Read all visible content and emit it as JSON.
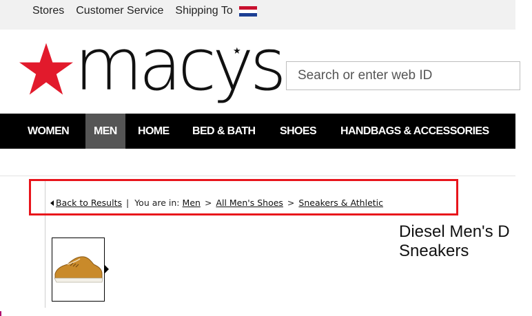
{
  "topbar": {
    "stores": "Stores",
    "customer_service": "Customer Service",
    "shipping_to": "Shipping To",
    "flag_icon": "us-flag-icon",
    "flag_colors": [
      "#c8102e",
      "#ffffff",
      "#1d3f94"
    ]
  },
  "brand": {
    "logo_text": "macys",
    "star_color": "#e21a2c"
  },
  "search": {
    "placeholder": "Search or enter web ID"
  },
  "nav": {
    "items": [
      {
        "label": "WOMEN"
      },
      {
        "label": "MEN",
        "active": true
      },
      {
        "label": "HOME"
      },
      {
        "label": "BED & BATH"
      },
      {
        "label": "SHOES"
      },
      {
        "label": "HANDBAGS & ACCESSORIES"
      }
    ]
  },
  "breadcrumb": {
    "back": "Back to Results",
    "separator": "|",
    "you_are_in": "You are in:",
    "crumbs": [
      "Men",
      "All Men's Shoes",
      "Sneakers & Athletic"
    ],
    "arrow": ">"
  },
  "product": {
    "title_line1": "Diesel Men's D",
    "title_line2": "Sneakers"
  },
  "colors": {
    "highlight_box": "#e8141b",
    "nav_bg": "#000000",
    "nav_active_bg": "#555555"
  }
}
